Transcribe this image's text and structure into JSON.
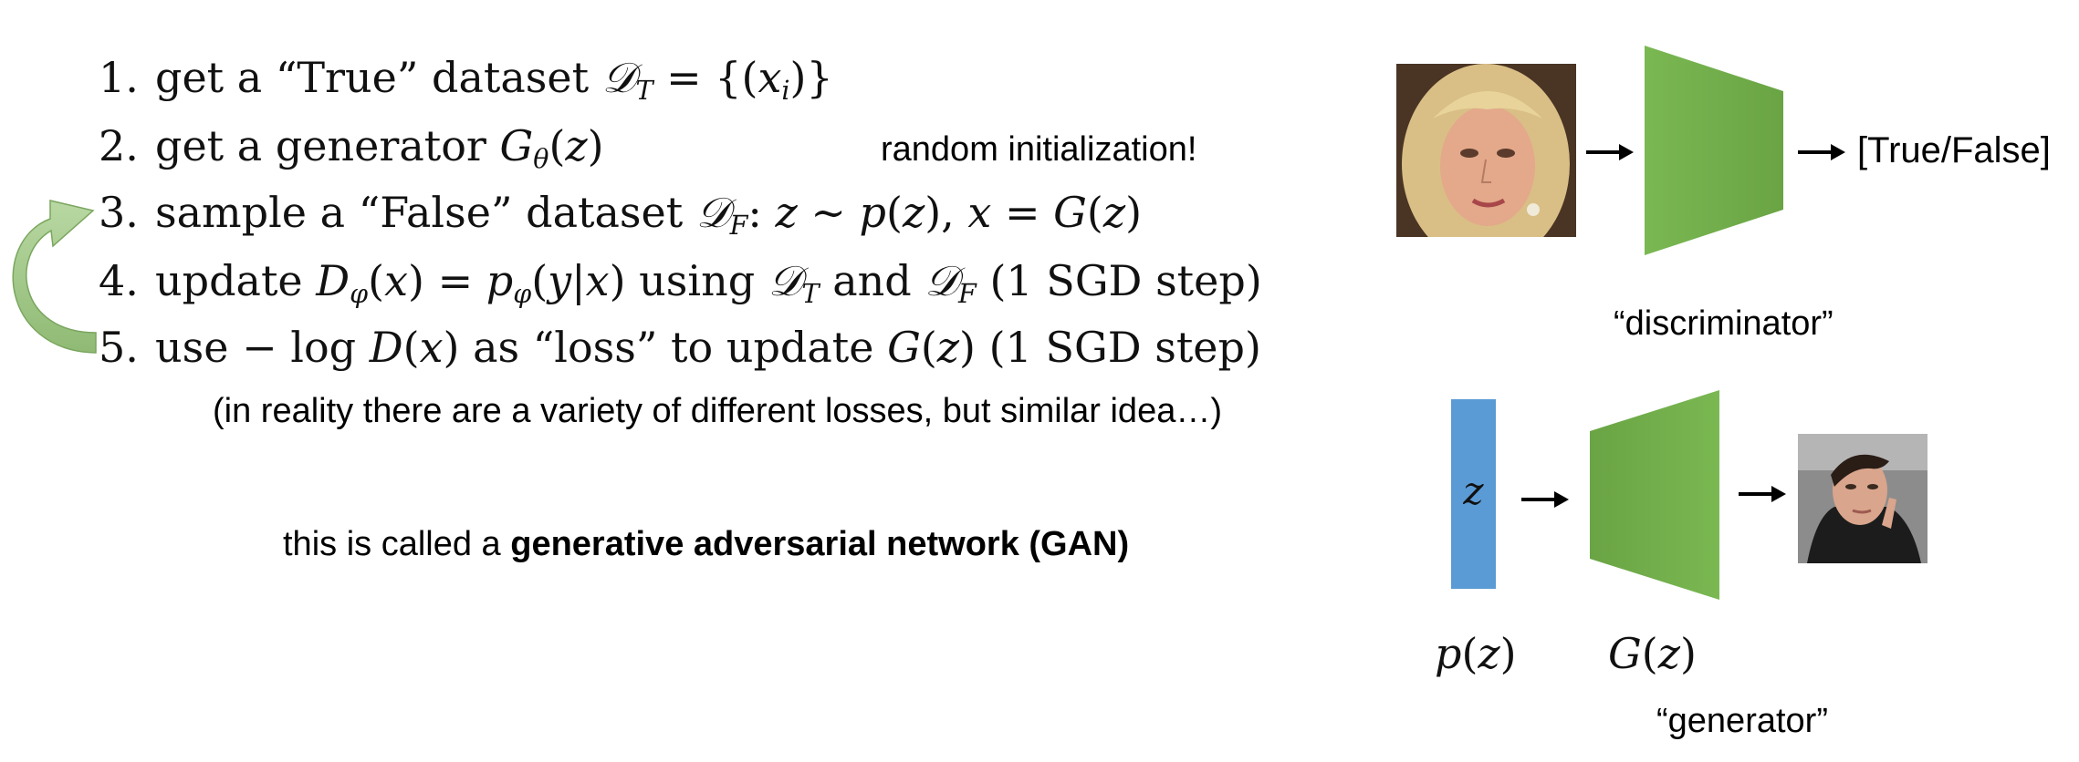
{
  "steps": [
    {
      "number": "1.",
      "text": "get a “True” dataset 𝒟_T = {(x_i)}"
    },
    {
      "number": "2.",
      "text": "get a generator G_θ(z)"
    },
    {
      "number": "3.",
      "text": "sample a “False” dataset 𝒟_F: z ∼ p(z), x = G(z)"
    },
    {
      "number": "4.",
      "text": "update D_φ(x) = p_φ(y|x) using 𝒟_T and 𝒟_F (1 SGD step)"
    },
    {
      "number": "5.",
      "text": "use −log D(x) as “loss” to update G(z) (1 SGD step)"
    }
  ],
  "annotations": {
    "random_init": "random initialization!",
    "reality_note": "(in reality there are a variety of different losses, but similar idea…)",
    "gan_prefix": "this is called a",
    "gan_bold": "generative adversarial network (GAN)"
  },
  "discriminator": {
    "output": "[True/False]",
    "caption": "“discriminator”"
  },
  "generator": {
    "z_label": "z",
    "pz_label": "p(z)",
    "gz_label": "G(z)",
    "caption": "“generator”"
  },
  "colors": {
    "network_green": "#70ad47",
    "latent_blue": "#5b9bd5",
    "loop_arrow": "#a9cd8f"
  }
}
